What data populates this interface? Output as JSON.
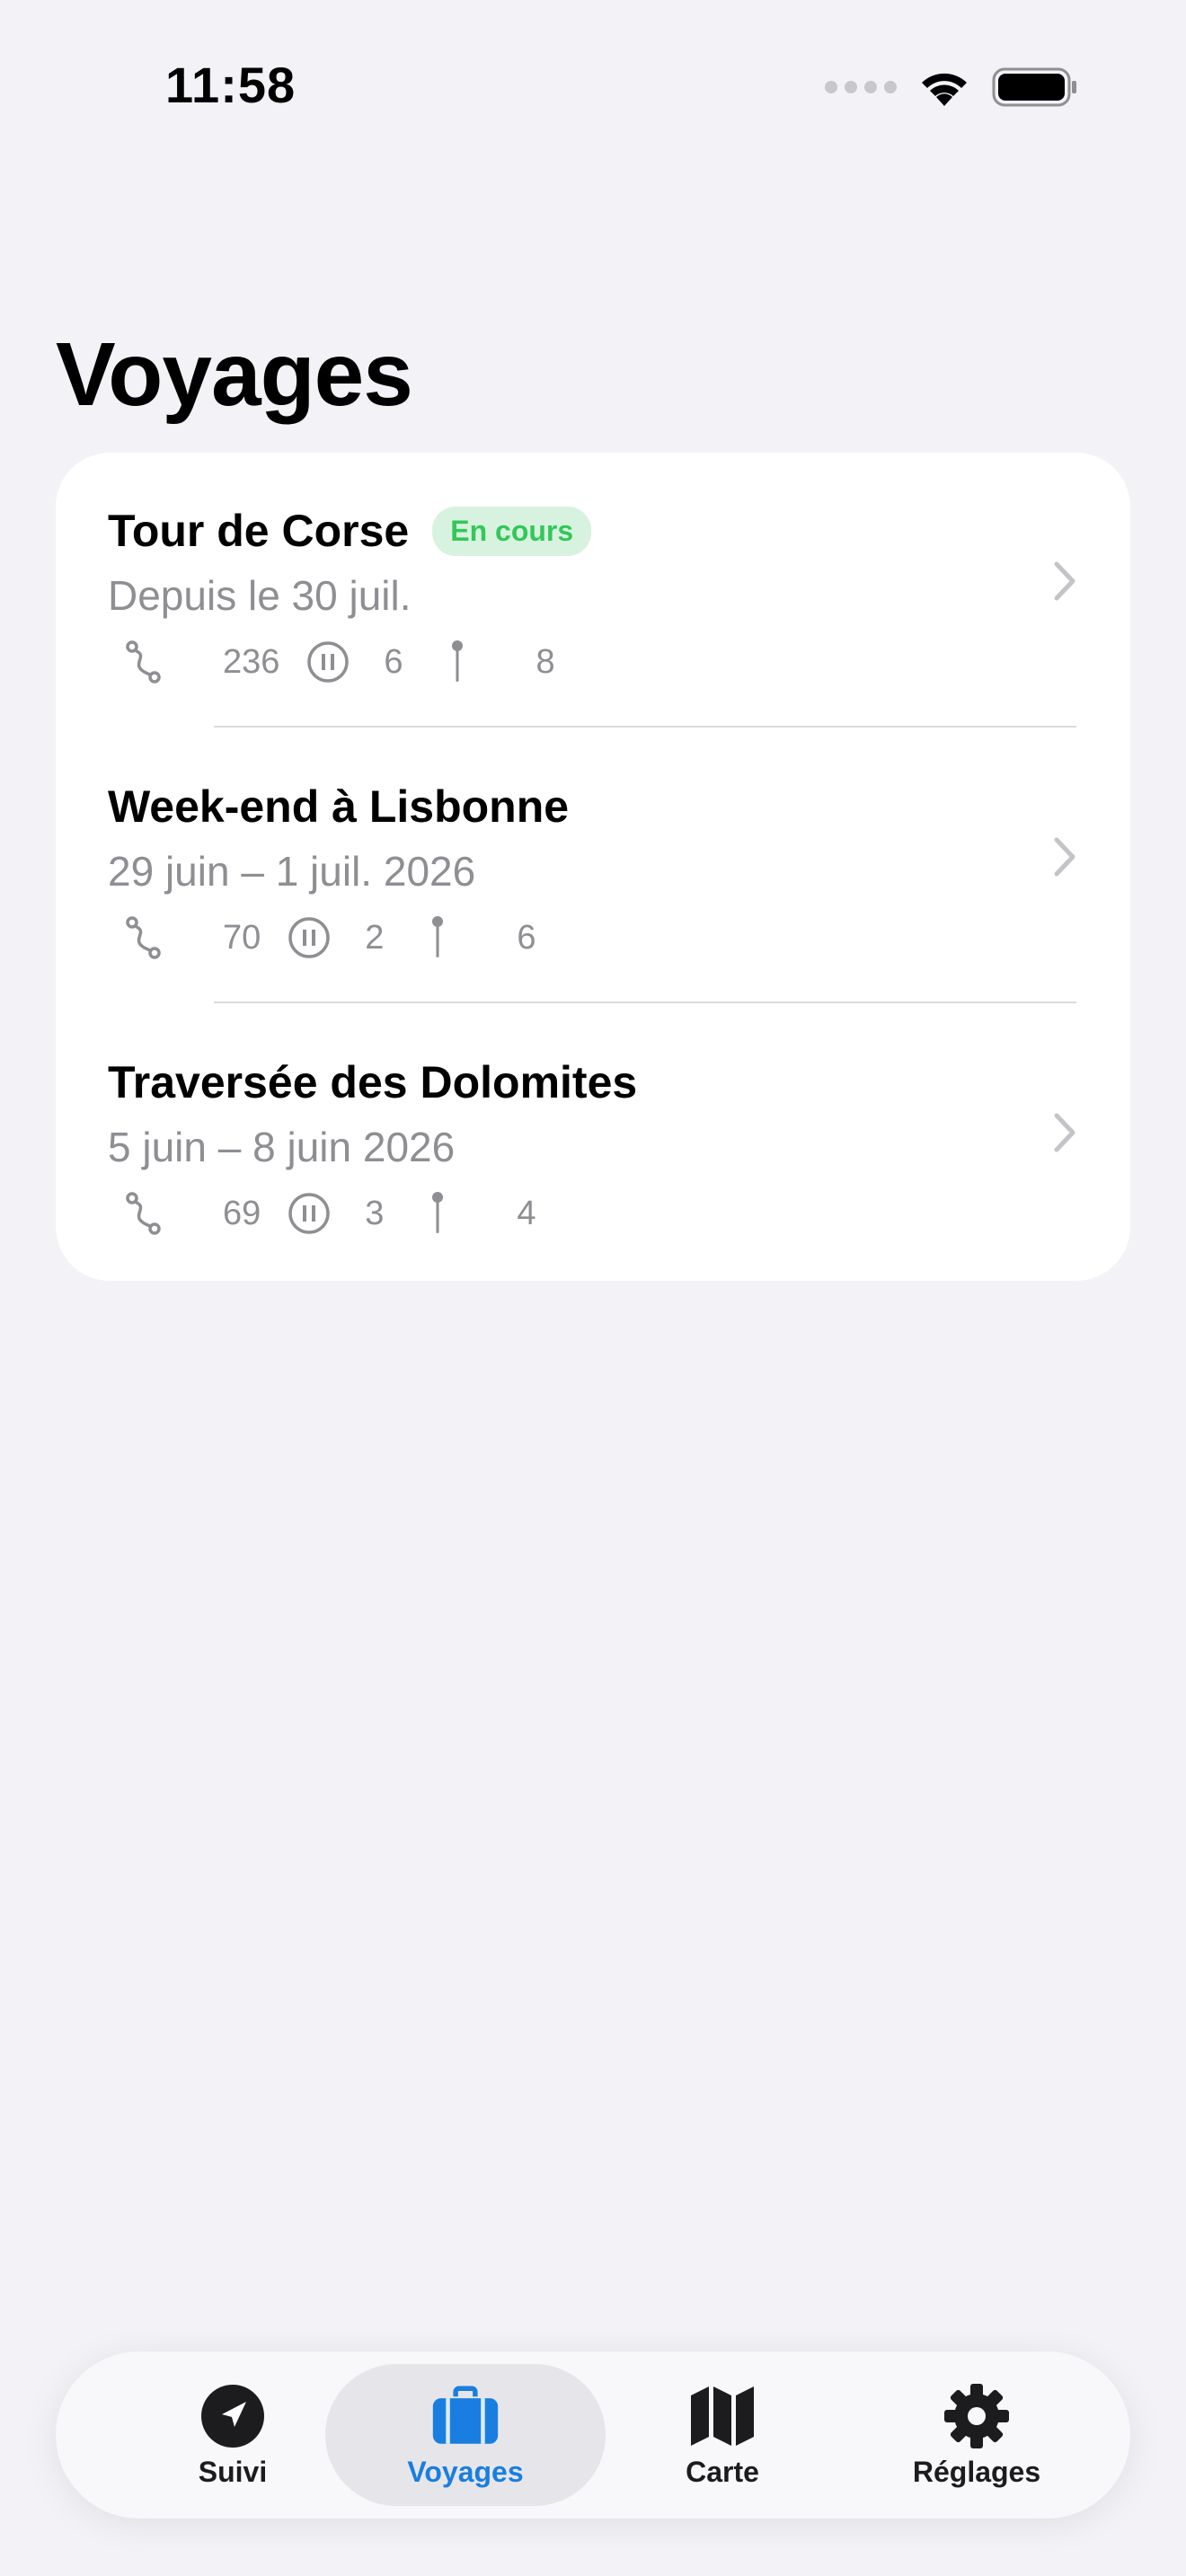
{
  "status_bar": {
    "time": "11:58"
  },
  "page_title": "Voyages",
  "trips": [
    {
      "title": "Tour de Corse",
      "badge": "En cours",
      "dates": "Depuis le 30 juil.",
      "stats": {
        "route": "236",
        "pauses": "6",
        "pins": "8"
      }
    },
    {
      "title": "Week-end à Lisbonne",
      "badge": "",
      "dates": "29 juin – 1 juil. 2026",
      "stats": {
        "route": "70",
        "pauses": "2",
        "pins": "6"
      }
    },
    {
      "title": "Traversée des Dolomites",
      "badge": "",
      "dates": "5 juin – 8 juin 2026",
      "stats": {
        "route": "69",
        "pauses": "3",
        "pins": "4"
      }
    }
  ],
  "tab_bar": {
    "tabs": [
      {
        "label": "Suivi",
        "icon": "location-arrow-icon"
      },
      {
        "label": "Voyages",
        "icon": "suitcase-icon",
        "active": true
      },
      {
        "label": "Carte",
        "icon": "map-icon"
      },
      {
        "label": "Réglages",
        "icon": "gear-icon"
      }
    ]
  },
  "colors": {
    "accent": "#1a7ee0",
    "badge_text": "#34c759",
    "badge_bg": "#d7f3df",
    "secondary_text": "#8e8e93",
    "background": "#f2f2f7"
  }
}
